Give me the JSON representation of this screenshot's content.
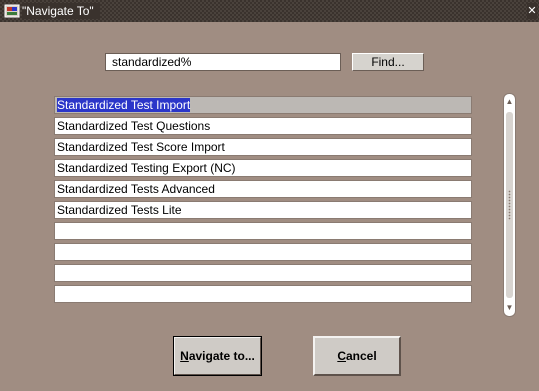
{
  "window": {
    "title": "\"Navigate To\"",
    "icon": "oracle-form-icon",
    "close_icon": "close-icon"
  },
  "search": {
    "value": "standardized%",
    "find_label": "Find..."
  },
  "results": [
    {
      "label": "Standardized Test Import",
      "selected": true
    },
    {
      "label": "Standardized Test Questions"
    },
    {
      "label": "Standardized Test Score Import"
    },
    {
      "label": "Standardized Testing Export (NC)"
    },
    {
      "label": "Standardized Tests Advanced"
    },
    {
      "label": "Standardized Tests Lite"
    },
    {
      "label": ""
    },
    {
      "label": ""
    },
    {
      "label": ""
    },
    {
      "label": ""
    }
  ],
  "buttons": {
    "navigate": {
      "mnemonic": "N",
      "rest": "avigate to..."
    },
    "cancel": {
      "mnemonic": "C",
      "rest": "ancel"
    }
  },
  "colors": {
    "background": "#a08d82",
    "selection": "#2b36c9",
    "titlebar": "#3a322d"
  }
}
